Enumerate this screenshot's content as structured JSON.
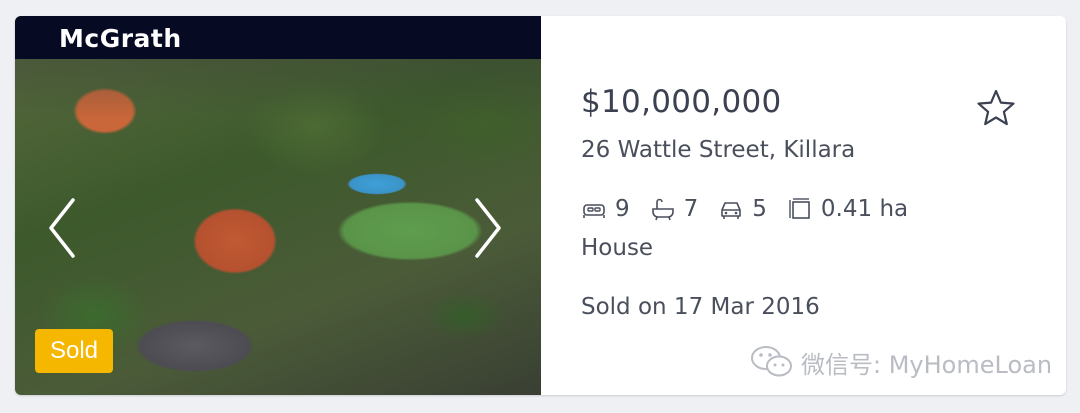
{
  "listing": {
    "brand": "McGrath",
    "badge": "Sold",
    "price": "$10,000,000",
    "address": "26 Wattle Street, Killara",
    "features": {
      "bedrooms": "9",
      "bathrooms": "7",
      "parking": "5",
      "land": "0.41 ha"
    },
    "property_type": "House",
    "sold_text": "Sold on 17 Mar 2016"
  },
  "watermark": {
    "text": "微信号: MyHomeLoan"
  },
  "icons": {
    "prev": "chevron-left-icon",
    "next": "chevron-right-icon",
    "favorite": "star-outline-icon",
    "bed": "bed-icon",
    "bath": "bath-icon",
    "car": "car-icon",
    "land": "land-size-icon"
  },
  "colors": {
    "brand_bar": "#060a22",
    "sold_badge": "#f6b700",
    "text": "#3b4150"
  }
}
